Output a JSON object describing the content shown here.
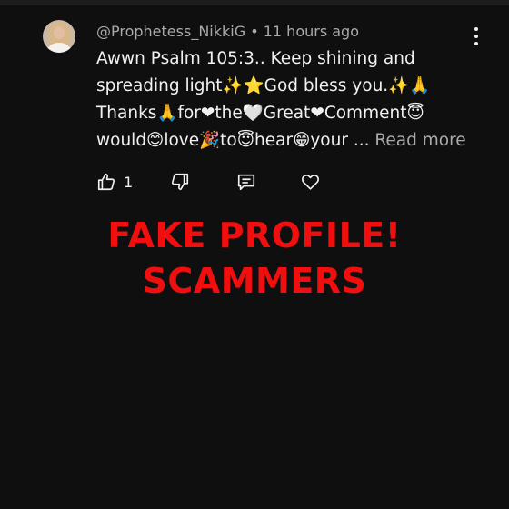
{
  "comment": {
    "author": "@Prophetess_NikkiG",
    "separator": "•",
    "time": "11 hours ago",
    "lines": [
      "Awwn Psalm 105:3.. Keep shining and",
      "spreading light✨⭐God bless you.✨🙏",
      "Thanks🙏for❤the🤍Great❤Comment😇",
      "would😊love🎉to😇hear😁your ..."
    ],
    "read_more": "Read more",
    "likes": "1"
  },
  "icons": {
    "more": "vertical-dots-icon",
    "like": "thumbs-up-icon",
    "dislike": "thumbs-down-icon",
    "reply": "reply-comment-icon",
    "heart": "heart-icon"
  },
  "overlay": {
    "line1": "FAKE PROFILE!",
    "line2": "SCAMMERS"
  },
  "colors": {
    "background": "#0f0f0f",
    "overlay_text": "#f00e0e",
    "meta_text": "#aaaaaa",
    "body_text": "#f1f1f1"
  }
}
